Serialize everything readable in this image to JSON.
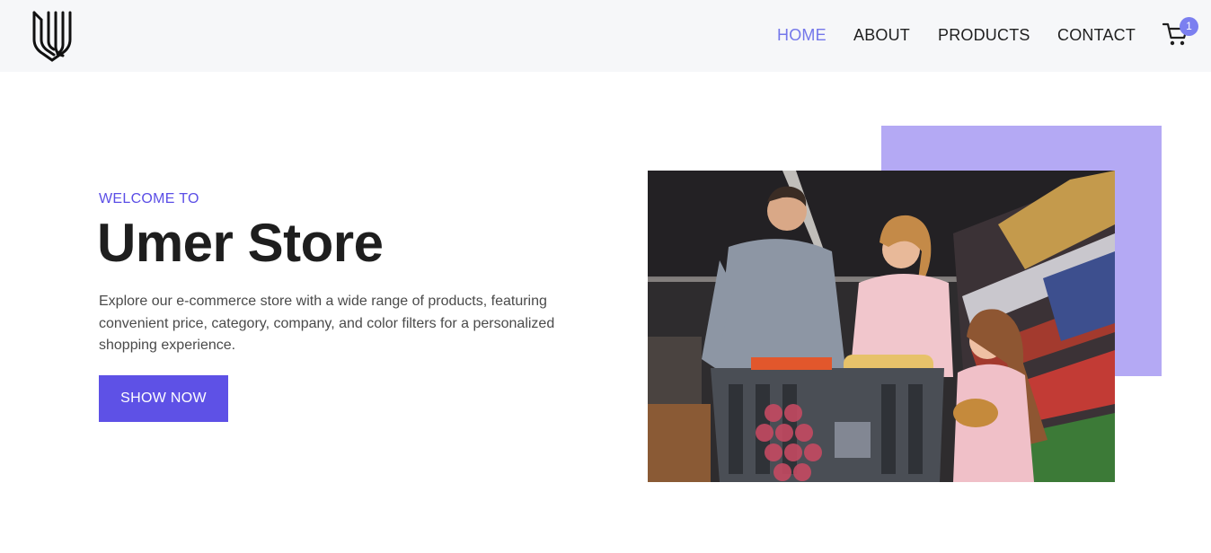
{
  "header": {
    "logo_icon": "shield-stripes-logo",
    "nav": [
      {
        "label": "HOME",
        "active": true
      },
      {
        "label": "ABOUT",
        "active": false
      },
      {
        "label": "PRODUCTS",
        "active": false
      },
      {
        "label": "CONTACT",
        "active": false
      }
    ],
    "cart": {
      "icon": "cart-icon",
      "count": "1"
    }
  },
  "hero": {
    "eyebrow": "WELCOME TO",
    "title": "Umer Store",
    "description": "Explore our e-commerce store with a wide range of products, featuring convenient price, category, company, and color filters for a personalized shopping experience.",
    "cta_label": "SHOW NOW",
    "image_subject": "family shopping with a cart in a supermarket aisle"
  },
  "colors": {
    "accent": "#5e51e6",
    "nav_active": "#7477ea",
    "accent_box": "#b4a9f4",
    "header_bg": "#f6f7f9"
  }
}
